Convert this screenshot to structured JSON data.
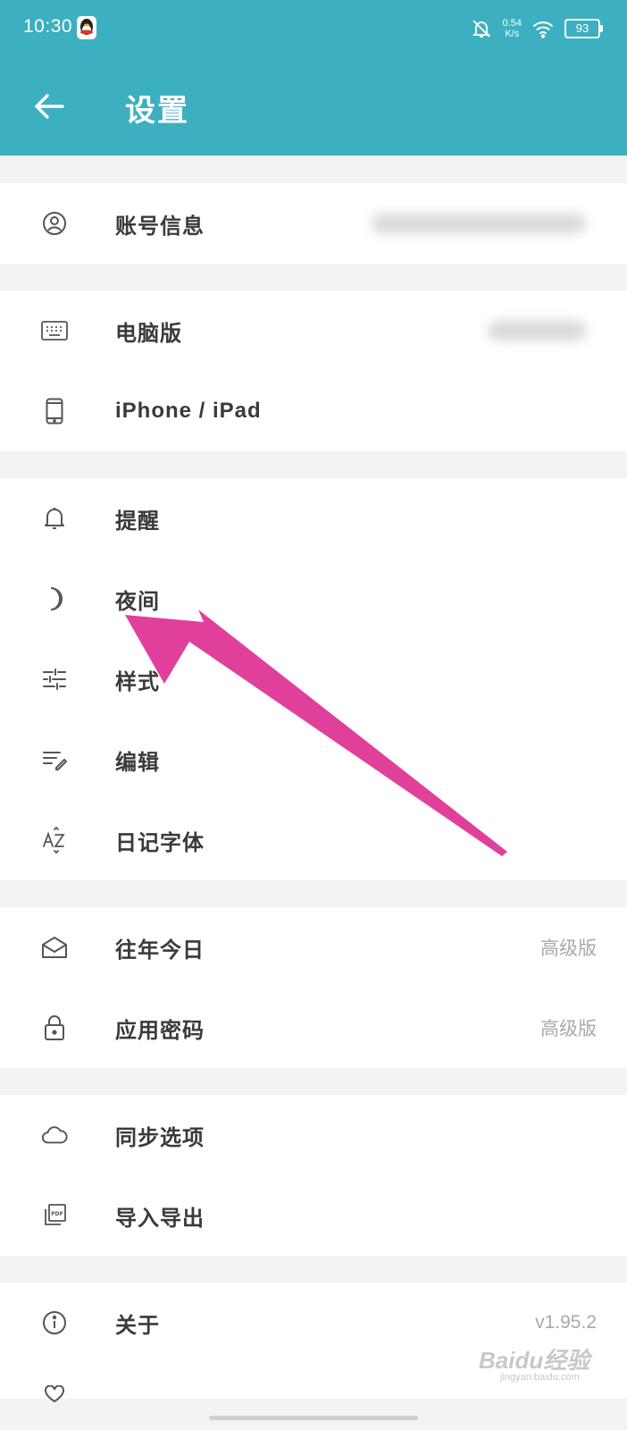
{
  "status_bar": {
    "time": "10:30",
    "net_speed_value": "0.54",
    "net_speed_unit": "K/s",
    "battery": "93"
  },
  "app_bar": {
    "title": "设置",
    "back_icon": "arrow-left-icon"
  },
  "groups": [
    {
      "rows": [
        {
          "icon": "account-icon",
          "label": "账号信息",
          "value_blurred": true
        }
      ]
    },
    {
      "rows": [
        {
          "icon": "keyboard-icon",
          "label": "电脑版",
          "value_blurred": true
        },
        {
          "icon": "phone-icon",
          "label": "iPhone / iPad"
        }
      ]
    },
    {
      "rows": [
        {
          "icon": "bell-icon",
          "label": "提醒"
        },
        {
          "icon": "moon-icon",
          "label": "夜间"
        },
        {
          "icon": "sliders-icon",
          "label": "样式"
        },
        {
          "icon": "edit-icon",
          "label": "编辑"
        },
        {
          "icon": "az-icon",
          "label": "日记字体"
        }
      ]
    },
    {
      "rows": [
        {
          "icon": "envelope-icon",
          "label": "往年今日",
          "value": "高级版"
        },
        {
          "icon": "lock-icon",
          "label": "应用密码",
          "value": "高级版"
        }
      ]
    },
    {
      "rows": [
        {
          "icon": "cloud-icon",
          "label": "同步选项"
        },
        {
          "icon": "pdf-icon",
          "label": "导入导出"
        }
      ]
    },
    {
      "rows": [
        {
          "icon": "info-icon",
          "label": "关于",
          "value": "v1.95.2"
        }
      ]
    }
  ],
  "annotation": {
    "color": "#e0409a"
  },
  "watermark": {
    "text": "Baidu经验",
    "url": "jingyan.baidu.com"
  },
  "colors": {
    "accent": "#3cb0c0",
    "background": "#f2f3f3"
  }
}
